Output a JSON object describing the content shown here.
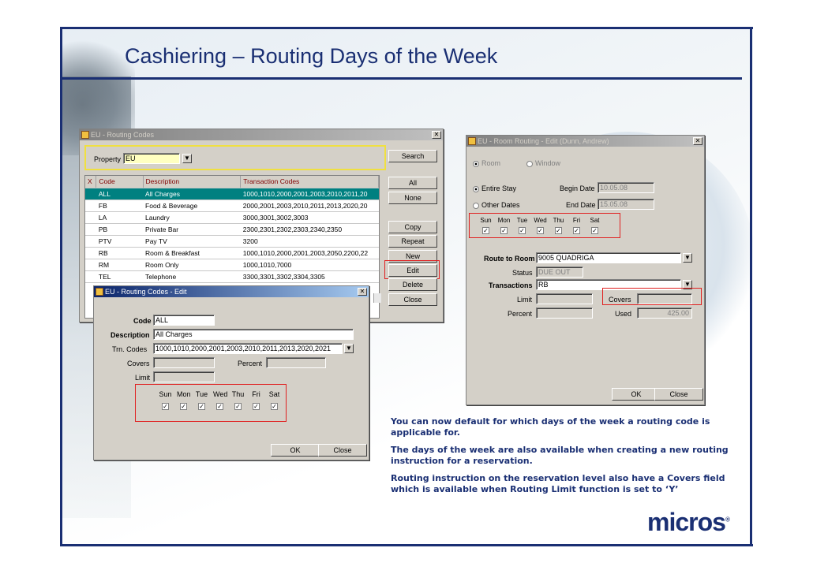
{
  "slide": {
    "title": "Cashiering – Routing Days of the Week",
    "notes": [
      "You can now default for which days of the week a routing code is applicable for.",
      "The days of the week are also available when creating a new routing instruction for a reservation.",
      "Routing instruction on the reservation level also have a Covers field which is available when Routing Limit function is set to ‘Y’"
    ],
    "logo": "micros",
    "logo_mark": "®"
  },
  "routing_codes": {
    "title": "EU - Routing Codes",
    "close": "✕",
    "property_label": "Property",
    "property_value": "EU",
    "columns": [
      "X",
      "Code",
      "Description",
      "Transaction Codes"
    ],
    "rows": [
      {
        "code": "ALL",
        "desc": "All Charges",
        "trx": "1000,1010,2000,2001,2003,2010,2011,20"
      },
      {
        "code": "FB",
        "desc": "Food & Beverage",
        "trx": "2000,2001,2003,2010,2011,2013,2020,20"
      },
      {
        "code": "LA",
        "desc": "Laundry",
        "trx": "3000,3001,3002,3003"
      },
      {
        "code": "PB",
        "desc": "Private Bar",
        "trx": "2300,2301,2302,2303,2340,2350"
      },
      {
        "code": "PTV",
        "desc": "Pay TV",
        "trx": "3200"
      },
      {
        "code": "RB",
        "desc": "Room & Breakfast",
        "trx": "1000,1010,2000,2001,2003,2050,2200,22"
      },
      {
        "code": "RM",
        "desc": "Room Only",
        "trx": "1000,1010,7000"
      },
      {
        "code": "TEL",
        "desc": "Telephone",
        "trx": "3300,3301,3302,3304,3305"
      }
    ],
    "buttons": [
      "Search",
      "All",
      "None",
      "Copy",
      "Repeat",
      "New",
      "Edit",
      "Delete",
      "Close"
    ]
  },
  "routing_edit": {
    "title": "EU - Routing Codes - Edit",
    "close": "✕",
    "code_label": "Code",
    "code_value": "ALL",
    "desc_label": "Description",
    "desc_value": "All Charges",
    "trn_label": "Trn. Codes",
    "trn_value": "1000,1010,2000,2001,2003,2010,2011,2013,2020,2021",
    "covers_label": "Covers",
    "percent_label": "Percent",
    "limit_label": "Limit",
    "days": [
      "Sun",
      "Mon",
      "Tue",
      "Wed",
      "Thu",
      "Fri",
      "Sat"
    ],
    "ok": "OK",
    "close_btn": "Close"
  },
  "room_routing": {
    "title": "EU - Room Routing - Edit (Dunn, Andrew)",
    "close": "✕",
    "room_label": "Room",
    "window_label": "Window",
    "entire_stay": "Entire Stay",
    "other_dates": "Other Dates",
    "begin_label": "Begin Date",
    "begin_value": "10.05.08",
    "end_label": "End Date",
    "end_value": "15.05.08",
    "days": [
      "Sun",
      "Mon",
      "Tue",
      "Wed",
      "Thu",
      "Fri",
      "Sat"
    ],
    "route_label": "Route to Room",
    "route_value": "9005  QUADRIGA",
    "status_label": "Status",
    "status_value": "DUE OUT",
    "trx_label": "Transactions",
    "trx_value": "RB",
    "limit_label": "Limit",
    "covers_label": "Covers",
    "percent_label": "Percent",
    "used_label": "Used",
    "used_value": "425.00",
    "ok": "OK",
    "close_btn": "Close"
  },
  "icons": {
    "dropdown": "▼",
    "check": "✓",
    "scroll_up": "▲",
    "scroll_down": "▼"
  }
}
